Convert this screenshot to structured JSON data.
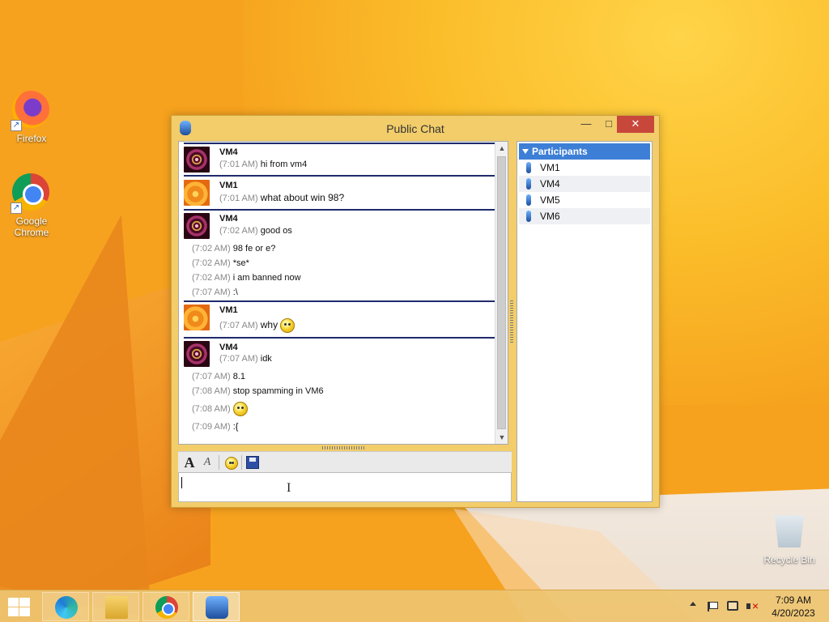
{
  "desktop": {
    "icons": [
      {
        "label": "Firefox",
        "icon": "firefox-icon"
      },
      {
        "label": "Google Chrome",
        "icon": "chrome-icon"
      },
      {
        "label": "Recycle Bin",
        "icon": "recycle-bin-icon"
      }
    ]
  },
  "chat_window": {
    "title": "Public Chat",
    "controls": {
      "minimize": "—",
      "maximize": "□",
      "close": "✕"
    },
    "messages": [
      {
        "sender": "VM4",
        "lines": [
          {
            "ts": "(7:01 AM)",
            "text": "hi from vm4"
          }
        ]
      },
      {
        "sender": "VM1",
        "lines": [
          {
            "ts": "(7:01 AM)",
            "text": "what about win 98?"
          }
        ]
      },
      {
        "sender": "VM4",
        "lines": [
          {
            "ts": "(7:02 AM)",
            "text": "good os"
          },
          {
            "ts": "(7:02 AM)",
            "text": "98 fe or e?"
          },
          {
            "ts": "(7:02 AM)",
            "text": "*se*"
          },
          {
            "ts": "(7:02 AM)",
            "text": "i am banned now"
          },
          {
            "ts": "(7:07 AM)",
            "text": ":\\"
          }
        ]
      },
      {
        "sender": "VM1",
        "lines": [
          {
            "ts": "(7:07 AM)",
            "text": "why",
            "emoji": "confused-emoji"
          }
        ]
      },
      {
        "sender": "VM4",
        "lines": [
          {
            "ts": "(7:07 AM)",
            "text": "idk"
          },
          {
            "ts": "(7:07 AM)",
            "text": "8.1"
          },
          {
            "ts": "(7:08 AM)",
            "text": "stop spamming in VM6"
          },
          {
            "ts": "(7:08 AM)",
            "text": "",
            "emoji": "sad-emoji"
          },
          {
            "ts": "(7:09 AM)",
            "text": ":{"
          }
        ]
      }
    ],
    "toolbar": {
      "font": "A",
      "style": "A"
    },
    "input": {
      "value": ""
    },
    "participants": {
      "header": "Participants",
      "items": [
        "VM1",
        "VM4",
        "VM5",
        "VM6"
      ]
    }
  },
  "taskbar": {
    "apps": [
      "edge-icon",
      "file-explorer-icon",
      "chrome-icon",
      "chat-app-icon"
    ],
    "clock": {
      "time": "7:09 AM",
      "date": "4/20/2023"
    }
  }
}
